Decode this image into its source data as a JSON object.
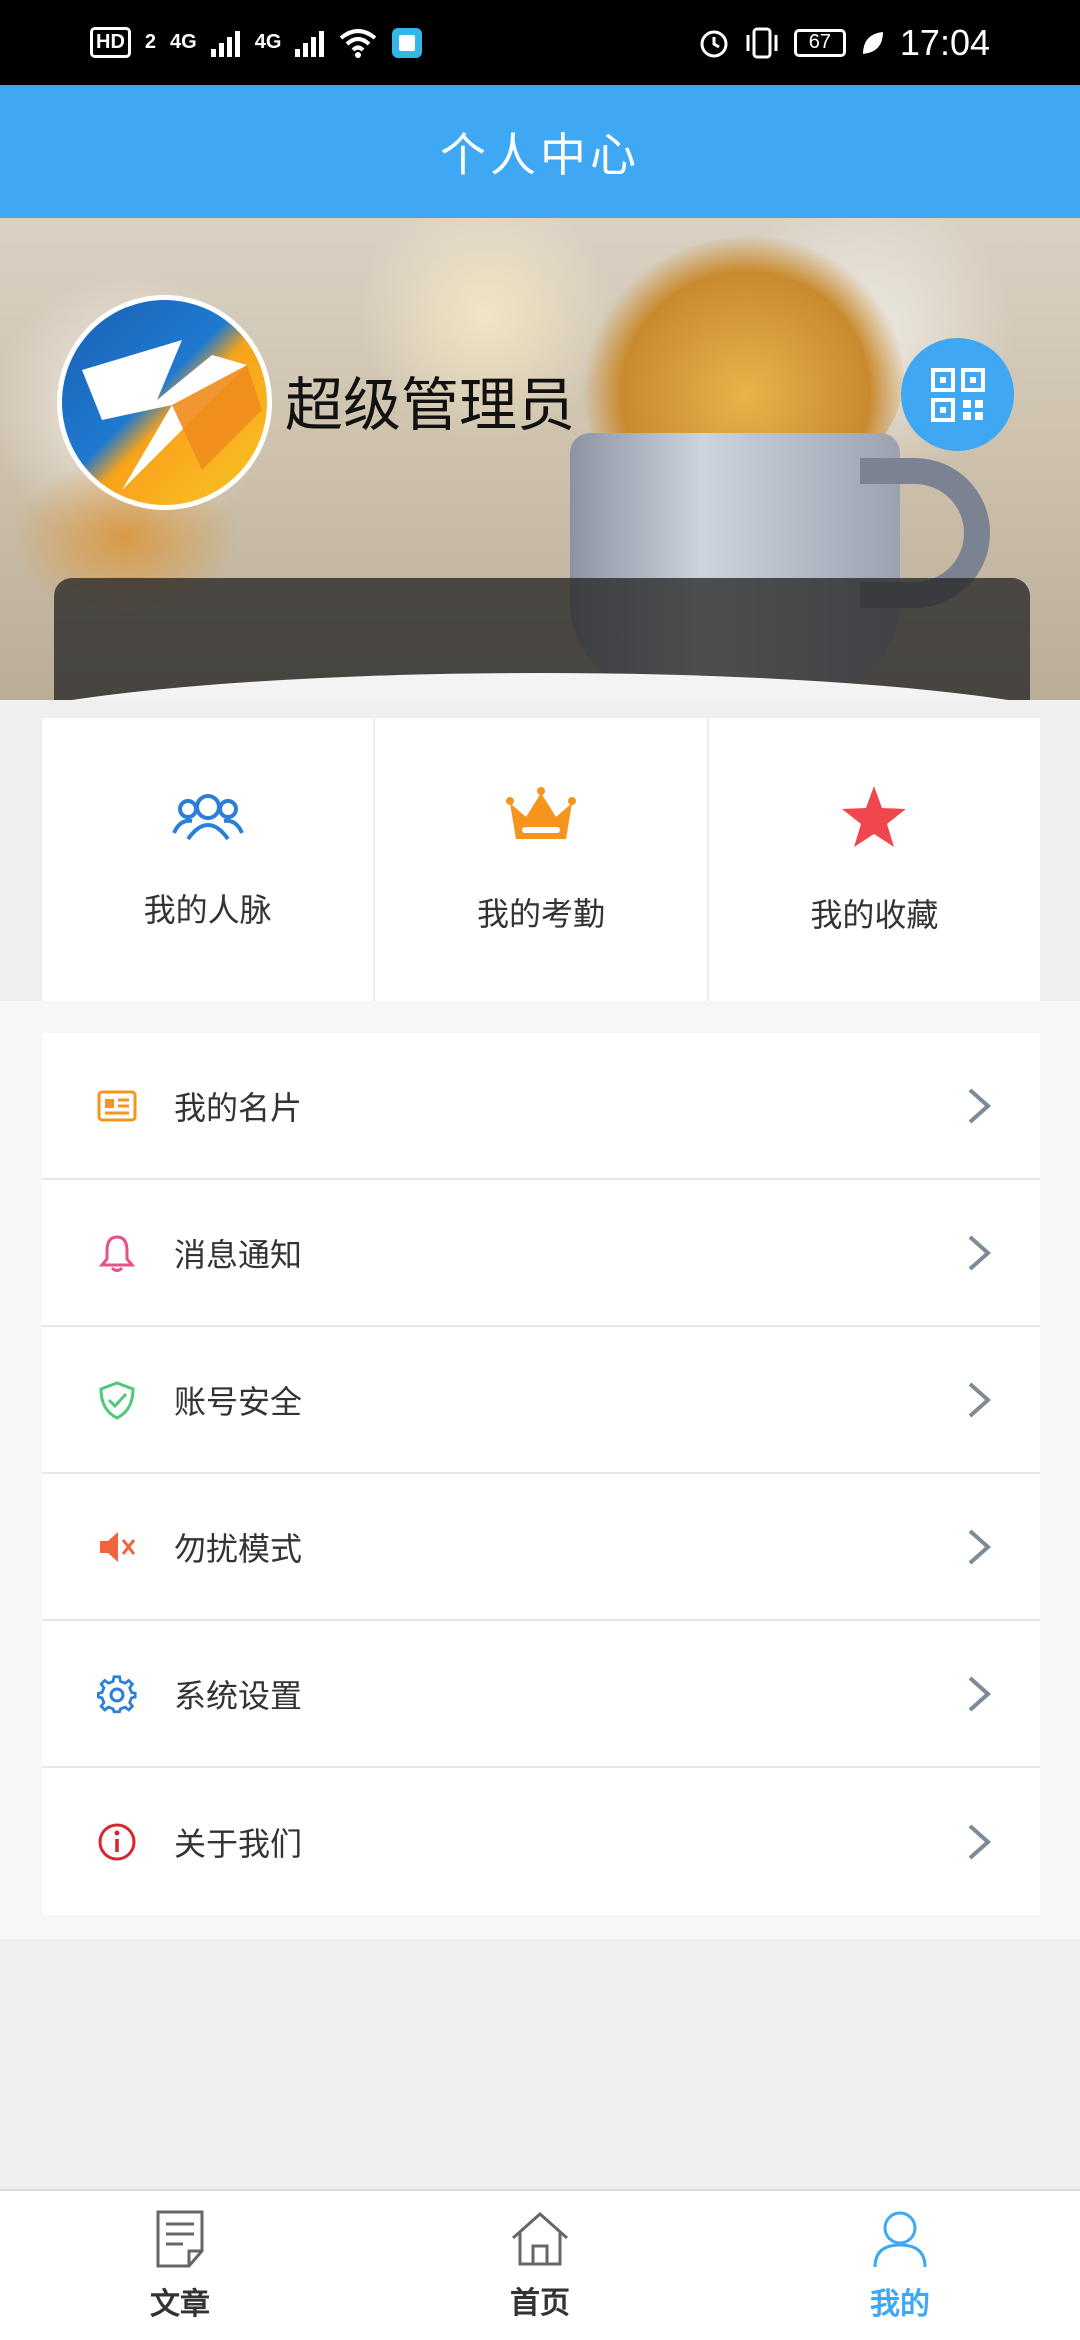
{
  "status_bar": {
    "hd": "HD",
    "hd_sub": "2",
    "net1": "4G",
    "net2": "4G",
    "battery": "67",
    "time": "17:04"
  },
  "header": {
    "title": "个人中心"
  },
  "profile": {
    "username": "超级管理员",
    "avatar_icon": "company-logo",
    "qr_icon": "qr-code-icon"
  },
  "quick_links": [
    {
      "label": "我的人脉",
      "icon": "contacts-icon",
      "color": "#2b7fd6"
    },
    {
      "label": "我的考勤",
      "icon": "crown-icon",
      "color": "#f7941d"
    },
    {
      "label": "我的收藏",
      "icon": "star-icon",
      "color": "#f0474f"
    }
  ],
  "menu": [
    {
      "label": "我的名片",
      "icon": "card-icon",
      "color": "#f7941d"
    },
    {
      "label": "消息通知",
      "icon": "bell-icon",
      "color": "#e8508a"
    },
    {
      "label": "账号安全",
      "icon": "shield-icon",
      "color": "#4ec97a"
    },
    {
      "label": "勿扰模式",
      "icon": "mute-icon",
      "color": "#f0643c"
    },
    {
      "label": "系统设置",
      "icon": "gear-icon",
      "color": "#2b7fd6"
    },
    {
      "label": "关于我们",
      "icon": "info-icon",
      "color": "#d9262c"
    }
  ],
  "bottom_nav": [
    {
      "label": "文章",
      "icon": "article-icon"
    },
    {
      "label": "首页",
      "icon": "home-icon"
    },
    {
      "label": "我的",
      "icon": "user-icon",
      "active": true
    }
  ],
  "colors": {
    "accent": "#3ea8f4"
  }
}
